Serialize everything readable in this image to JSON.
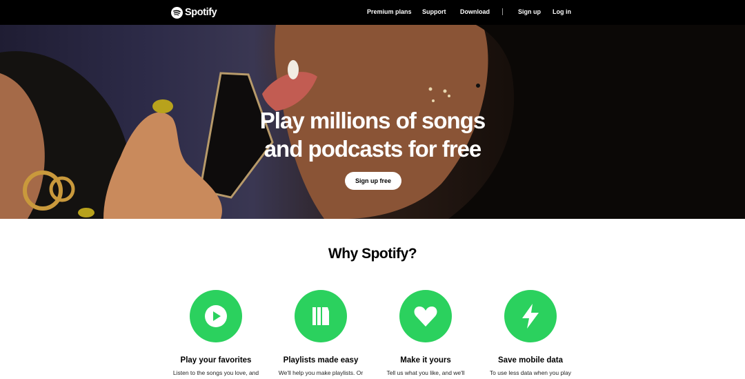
{
  "nav": {
    "brand": "Spotify",
    "logo_icon": "spotify-logo-icon",
    "links": [
      "Premium plans",
      "Support",
      "Download"
    ],
    "auth": [
      "Sign up",
      "Log in"
    ]
  },
  "hero": {
    "title_line1": "Play millions of songs",
    "title_line2": "and podcasts for free",
    "cta": "Sign up free"
  },
  "why": {
    "title": "Why Spotify?",
    "features": [
      {
        "icon": "play-icon",
        "title": "Play your favorites",
        "desc": "Listen to the songs you love, and"
      },
      {
        "icon": "library-icon",
        "title": "Playlists made easy",
        "desc": "We'll help you make playlists. Or"
      },
      {
        "icon": "heart-icon",
        "title": "Make it yours",
        "desc": "Tell us what you like, and we'll"
      },
      {
        "icon": "lightning-icon",
        "title": "Save mobile data",
        "desc": "To use less data when you play"
      }
    ]
  },
  "colors": {
    "brand_green": "#2bd15e",
    "nav_bg": "#000000",
    "cta_bg": "#ffffff"
  }
}
